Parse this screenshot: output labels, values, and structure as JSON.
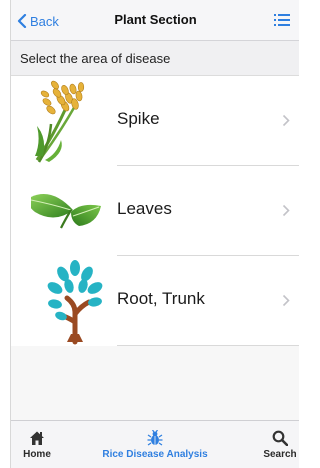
{
  "navbar": {
    "back_label": "Back",
    "title": "Plant Section",
    "menu_icon": "list-icon"
  },
  "subheader": {
    "text": "Select the area of disease"
  },
  "items": [
    {
      "label": "Spike",
      "icon": "wheat-spike-icon"
    },
    {
      "label": "Leaves",
      "icon": "leaves-icon"
    },
    {
      "label": "Root, Trunk",
      "icon": "tree-icon"
    }
  ],
  "tabbar": {
    "tabs": [
      {
        "label": "Home",
        "icon": "home-icon"
      },
      {
        "label": "Rice Disease Analysis",
        "icon": "bug-icon",
        "active": true
      },
      {
        "label": "Search",
        "icon": "search-icon"
      }
    ]
  },
  "colors": {
    "accent": "#2f7fe0",
    "leaf_green": "#3e9a2a",
    "tree_teal": "#26b3c4",
    "trunk_brown": "#9a4a22",
    "wheat_gold": "#e6b23a"
  }
}
